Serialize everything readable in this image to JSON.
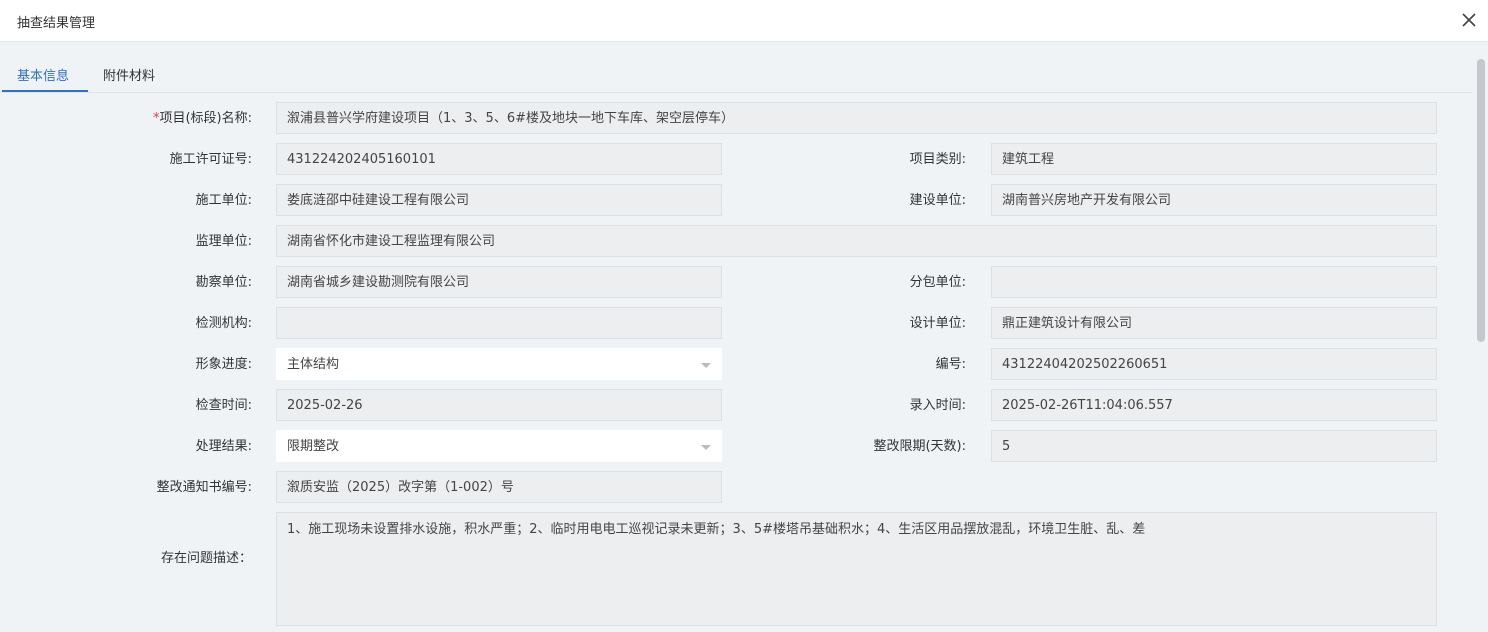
{
  "window": {
    "title": "抽查结果管理"
  },
  "tabs": [
    "基本信息",
    "附件材料"
  ],
  "form": {
    "project_name_label": "项目(标段)名称:",
    "project_name": "溆浦县普兴学府建设项目（1、3、5、6#楼及地块一地下车库、架空层停车）",
    "permit_label": "施工许可证号:",
    "permit": "431224202405160101",
    "category_label": "项目类别:",
    "category": "建筑工程",
    "construction_unit_label": "施工单位:",
    "construction_unit": "娄底涟邵中硅建设工程有限公司",
    "build_unit_label": "建设单位:",
    "build_unit": "湖南普兴房地产开发有限公司",
    "supervision_label": "监理单位:",
    "supervision": "湖南省怀化市建设工程监理有限公司",
    "survey_label": "勘察单位:",
    "survey": "湖南省城乡建设勘测院有限公司",
    "subcontract_label": "分包单位:",
    "subcontract": "",
    "testing_label": "检测机构:",
    "testing": "",
    "design_label": "设计单位:",
    "design": "鼎正建筑设计有限公司",
    "progress_label": "形象进度:",
    "progress": "主体结构",
    "number_label": "编号:",
    "number": "43122404202502260651",
    "check_time_label": "检查时间:",
    "check_time": "2025-02-26",
    "entry_time_label": "录入时间:",
    "entry_time": "2025-02-26T11:04:06.557",
    "result_label": "处理结果:",
    "result": "限期整改",
    "deadline_label": "整改限期(天数):",
    "deadline": "5",
    "notice_label": "整改通知书编号:",
    "notice": "溆质安监（2025）改字第（1-002）号",
    "issues_label": "存在问题描述：",
    "issues": "1、施工现场未设置排水设施，积水严重；2、临时用电电工巡视记录未更新；3、5#楼塔吊基础积水；4、生活区用品摆放混乱，环境卫生脏、乱、差"
  },
  "colors": {
    "accent": "#2f6fbd",
    "required": "#e0393e"
  },
  "icons": {
    "close": "close-icon",
    "caret": "chevron-down-icon"
  }
}
